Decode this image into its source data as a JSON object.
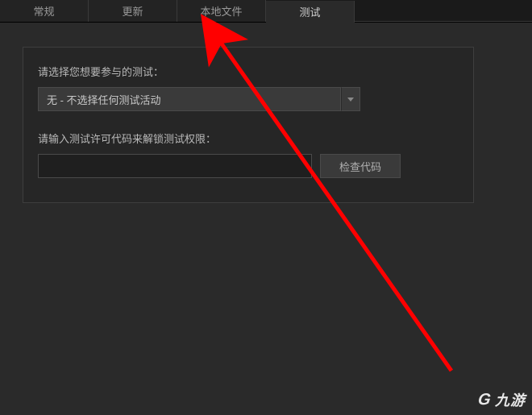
{
  "tabs": {
    "items": [
      {
        "label": "常规",
        "active": false
      },
      {
        "label": "更新",
        "active": false
      },
      {
        "label": "本地文件",
        "active": false
      },
      {
        "label": "测试",
        "active": true
      }
    ]
  },
  "beta": {
    "select_label": "请选择您想要参与的测试：",
    "selected_value": "无 - 不选择任何测试活动",
    "code_label": "请输入测试许可代码来解锁测试权限：",
    "code_value": "",
    "check_button": "检查代码"
  },
  "watermark": {
    "text": "九游"
  },
  "colors": {
    "bg": "#2a2a2a",
    "panel": "#262626",
    "border": "#3e3e3e",
    "input_bg": "#1f1f1f",
    "accent_arrow": "#ff0000"
  }
}
